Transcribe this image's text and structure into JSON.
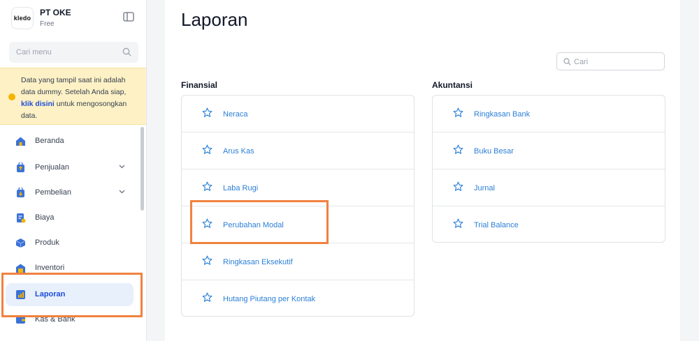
{
  "company": {
    "logo_text": "kledo",
    "name": "PT OKE",
    "plan": "Free"
  },
  "sidebar": {
    "search_placeholder": "Cari menu",
    "notice": {
      "text_before": "Data yang tampil saat ini adalah data dummy. Setelah Anda siap, ",
      "link": "klik disini",
      "text_after": " untuk mengosongkan data."
    },
    "items": [
      {
        "label": "Beranda",
        "icon": "home-icon"
      },
      {
        "label": "Penjualan",
        "icon": "sales-icon",
        "expandable": true
      },
      {
        "label": "Pembelian",
        "icon": "purchase-icon",
        "expandable": true
      },
      {
        "label": "Biaya",
        "icon": "expense-icon"
      },
      {
        "label": "Produk",
        "icon": "product-icon"
      },
      {
        "label": "Inventori",
        "icon": "inventory-icon"
      },
      {
        "label": "Laporan",
        "icon": "report-icon",
        "active": true
      },
      {
        "label": "Kas & Bank",
        "icon": "wallet-icon"
      }
    ]
  },
  "main": {
    "title": "Laporan",
    "search_placeholder": "Cari",
    "sections": [
      {
        "title": "Finansial",
        "items": [
          "Neraca",
          "Arus Kas",
          "Laba Rugi",
          "Perubahan Modal",
          "Ringkasan Eksekutif",
          "Hutang Piutang per Kontak"
        ]
      },
      {
        "title": "Akuntansi",
        "items": [
          "Ringkasan Bank",
          "Buku Besar",
          "Jurnal",
          "Trial Balance"
        ]
      }
    ]
  },
  "colors": {
    "accent": "#2b7fd6",
    "highlight": "#f0823f",
    "notice_bg": "#fdf1c5",
    "active_bg": "#e8f0fc"
  }
}
